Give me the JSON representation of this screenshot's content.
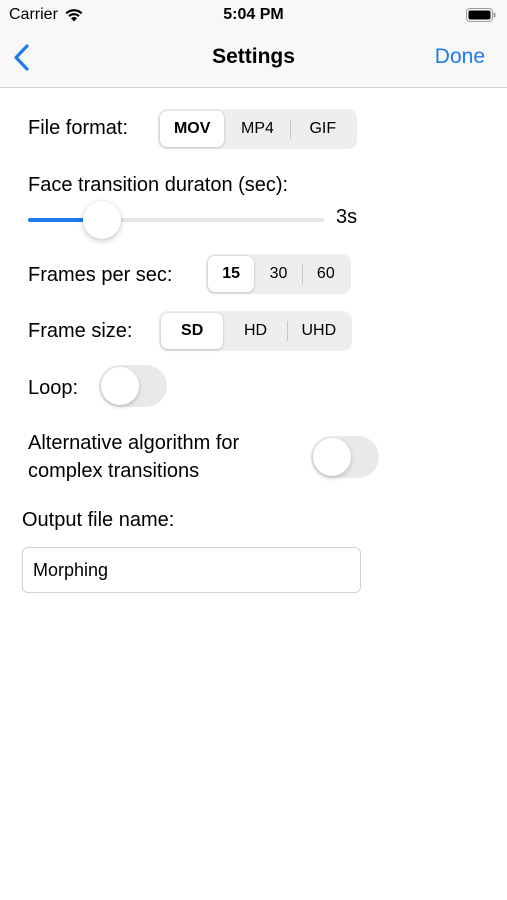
{
  "status_bar": {
    "carrier": "Carrier",
    "time": "5:04 PM",
    "icons": [
      "wifi-icon",
      "battery-icon"
    ]
  },
  "nav": {
    "back_icon": "chevron-left-icon",
    "title": "Settings",
    "done_label": "Done",
    "accent_color": "#1f7aeb"
  },
  "file_format": {
    "label": "File format:",
    "options": [
      "MOV",
      "MP4",
      "GIF"
    ],
    "selected": "MOV"
  },
  "face_transition": {
    "label": "Face transition duraton (sec):",
    "value_text": "3s",
    "fill_fraction": 0.25
  },
  "frames_per_sec": {
    "label": "Frames per sec:",
    "options": [
      "15",
      "30",
      "60"
    ],
    "selected": "15"
  },
  "frame_size": {
    "label": "Frame size:",
    "options": [
      "SD",
      "HD",
      "UHD"
    ],
    "selected": "SD"
  },
  "loop": {
    "label": "Loop:",
    "on": false
  },
  "alt_algorithm": {
    "label_line1": "Alternative algorithm for",
    "label_line2": "complex transitions",
    "on": false
  },
  "output": {
    "label": "Output file name:",
    "value": "Morphing"
  }
}
